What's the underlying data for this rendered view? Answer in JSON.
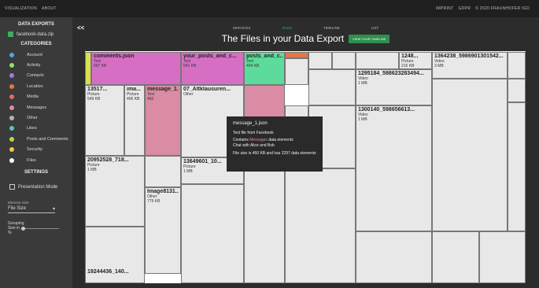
{
  "topbar": {
    "left": [
      "VISUALIZATION",
      "ABOUT"
    ],
    "right": [
      "IMPRINT",
      "GDPR",
      "© 2020 FRAUNHOFER IGD"
    ]
  },
  "sidebar": {
    "exports_title": "DATA EXPORTS",
    "file": "facebook-data.zip",
    "categories_title": "CATEGORIES",
    "categories": [
      {
        "label": "Account",
        "color": "#4aa8d8"
      },
      {
        "label": "Activity",
        "color": "#8ee36b"
      },
      {
        "label": "Contacts",
        "color": "#9d7bd9"
      },
      {
        "label": "Location",
        "color": "#e07b3a"
      },
      {
        "label": "Media",
        "color": "#e06d62"
      },
      {
        "label": "Messages",
        "color": "#e089a9"
      },
      {
        "label": "Other",
        "color": "#b3b3b3"
      },
      {
        "label": "Likes",
        "color": "#5ec4b6"
      },
      {
        "label": "Posts and Comments",
        "color": "#b2d94a"
      },
      {
        "label": "Security",
        "color": "#f0c93a"
      },
      {
        "label": "Files",
        "color": "#ffffff"
      }
    ],
    "settings_title": "SETTINGS",
    "presentation": "Presentation Mode",
    "element_size_label": "Element Size",
    "element_size_value": "File Size",
    "grouping_label": "Grouping",
    "size_in_label": "Size in",
    "size_unit": "%"
  },
  "main": {
    "back": "<<",
    "tabs": [
      "SERVICES",
      "FILES",
      "TIMELINE",
      "LIST"
    ],
    "title": "The Files in your Data Export",
    "timeline_btn": "VIEW YOUR TIMELINE"
  },
  "tiles": [
    {
      "n": "comments.json",
      "t": "Text",
      "s": "557 KB"
    },
    {
      "n": "your_posts_and_c...",
      "t": "Text",
      "s": "541 KB"
    },
    {
      "n": "posts_and_c...",
      "t": "Text",
      "s": "494 KB"
    },
    {
      "n": "13517...",
      "t": "Picture",
      "s": "549 KB"
    },
    {
      "n": "ima...",
      "t": "Picture",
      "s": "406 KB"
    },
    {
      "n": "message_1...",
      "t": "Text",
      "s": "460"
    },
    {
      "n": "07_Altklausuren...",
      "t": "Other",
      "s": ""
    },
    {
      "n": "20952528_718...",
      "t": "Picture",
      "s": "1 MB"
    },
    {
      "n": "13649601_10...",
      "t": "Picture",
      "s": "1 MB"
    },
    {
      "n": "Image8131...",
      "t": "Other",
      "s": "779 KB"
    },
    {
      "n": "19244436_140..."
    },
    {
      "n": "1364238_5986901301542...",
      "t": "Video",
      "s": "3 MB"
    },
    {
      "n": "1295184_598623283494...",
      "t": "Video",
      "s": "1 MB"
    },
    {
      "n": "1300140_598656613...",
      "t": "Video",
      "s": "1 MB"
    },
    {
      "n": "1248...",
      "t": "Picture",
      "s": "216 KB"
    }
  ],
  "tooltip": {
    "title": "message_1.json",
    "type": "Text file from Facebook",
    "contains_pre": "Contains",
    "contains_hl": "Messages",
    "contains_post": "data elements",
    "chat": "Chat with Alice and Bob",
    "size": "File size is 460 KB and has 2297 data elements"
  }
}
